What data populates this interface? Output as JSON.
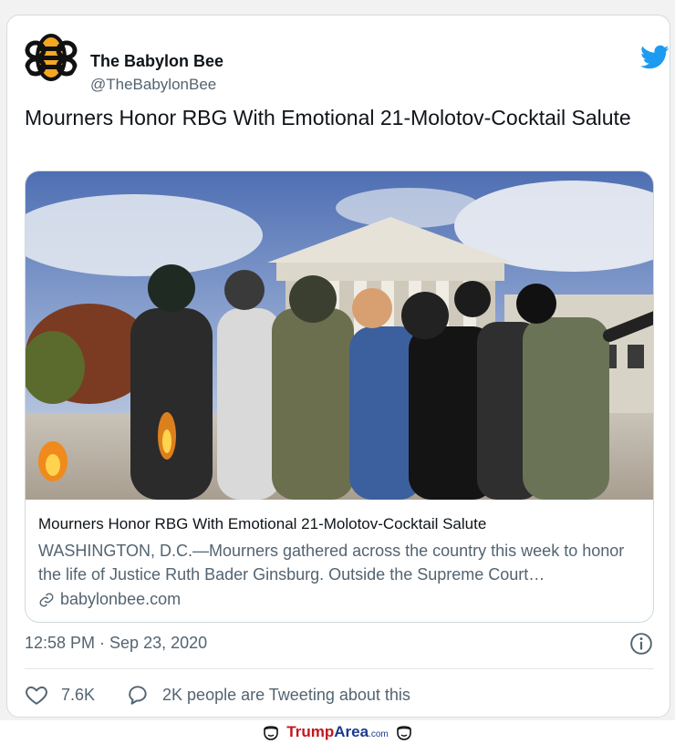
{
  "tweet": {
    "author_name": "The Babylon Bee",
    "author_handle": "@TheBabylonBee",
    "text": "Mourners Honor RBG With Emotional 21-Molotov-Cocktail Salute",
    "timestamp": "12:58 PM · Sep 23, 2020"
  },
  "link_card": {
    "title": "Mourners Honor RBG With Emotional 21-Molotov-Cocktail Salute",
    "description": "WASHINGTON, D.C.—Mourners gathered across the country this week to honor the life of Justice Ruth Bader Ginsburg. Outside the Supreme Court…",
    "domain": "babylonbee.com"
  },
  "actions": {
    "like_count": "7.6K",
    "reply_text": "2K people are Tweeting about this"
  },
  "footer": {
    "brand_part1": "Trump",
    "brand_part2": "Area",
    "brand_part3": ".com"
  },
  "icons": {
    "avatar": "babylon-bee-logo",
    "twitter": "twitter-bird-icon",
    "info": "info-icon",
    "like": "heart-icon",
    "reply": "speech-bubble-icon",
    "link": "link-chain-icon"
  },
  "colors": {
    "twitter_blue": "#1d9bf0",
    "bee_yellow": "#f5a623",
    "muted_text": "#536471",
    "brand_red": "#c4161c",
    "brand_blue": "#1b3a8c"
  }
}
